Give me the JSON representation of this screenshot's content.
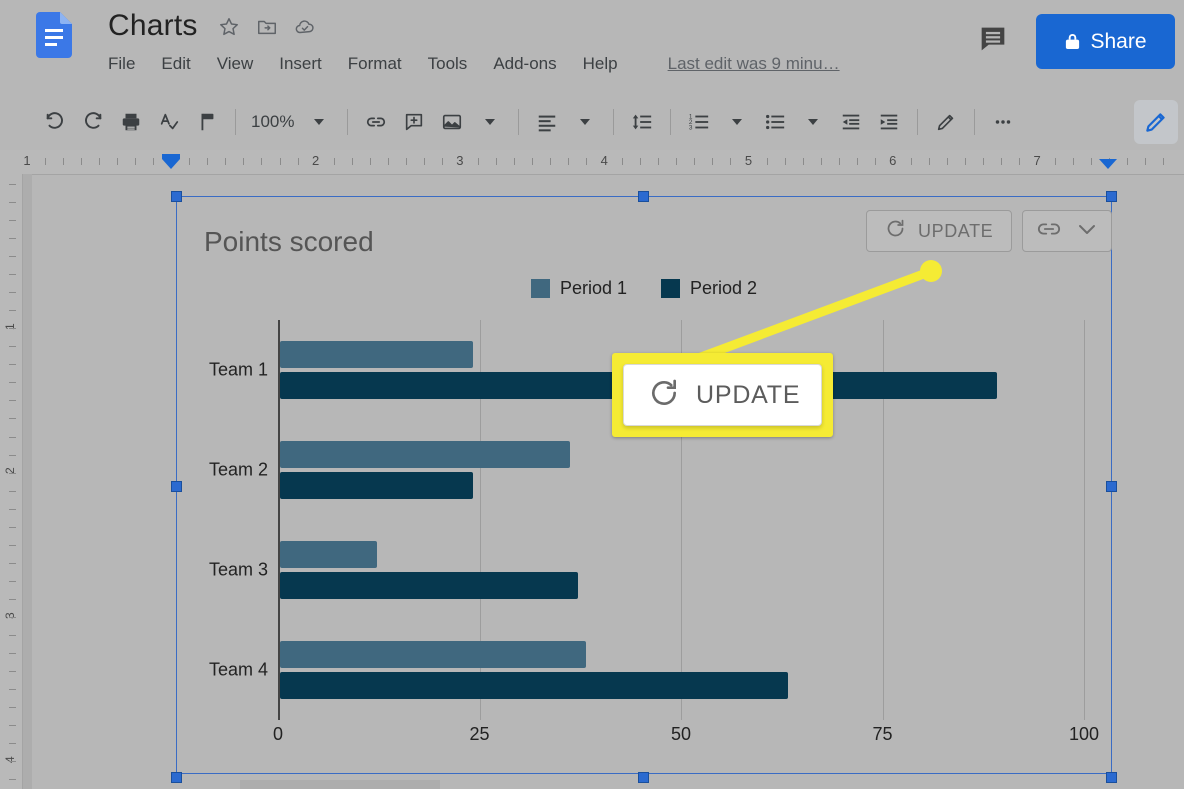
{
  "app": {
    "doc_title": "Charts",
    "logo_icon": "google-docs-icon",
    "title_icons": [
      "star-icon",
      "move-to-folder-icon",
      "cloud-saved-icon"
    ],
    "menus": [
      "File",
      "Edit",
      "View",
      "Insert",
      "Format",
      "Tools",
      "Add-ons",
      "Help"
    ],
    "last_edit": "Last edit was 9 minu…",
    "comment_icon": "comment-icon",
    "share_label": "Share",
    "share_icon": "lock-icon",
    "share_color": "#1967d2"
  },
  "toolbar": {
    "zoom_value": "100%",
    "items": [
      "undo-icon",
      "redo-icon",
      "print-icon",
      "spelling-check-icon",
      "paint-format-icon",
      "link-icon",
      "add-comment-icon",
      "insert-image-icon",
      "align-icon",
      "line-spacing-icon",
      "numbered-list-icon",
      "bulleted-list-icon",
      "decrease-indent-icon",
      "increase-indent-icon",
      "pencil-icon",
      "more-options-icon"
    ],
    "edit-mode-icon": "pencil-icon"
  },
  "ruler": {
    "horizontal_numbers": [
      "1",
      "1",
      "2",
      "3",
      "4",
      "5",
      "6",
      "7"
    ],
    "vertical_numbers": [
      "1",
      "2",
      "3",
      "4"
    ]
  },
  "chart_tools": {
    "update_label": "UPDATE",
    "update_icon": "refresh-icon",
    "link_icon": "link-icon",
    "dropdown_icon": "chevron-down-icon"
  },
  "callout": {
    "label": "UPDATE",
    "icon": "refresh-icon",
    "highlight_color": "#f5eb34"
  },
  "chart_data": {
    "type": "bar",
    "orientation": "horizontal",
    "title": "Points scored",
    "categories": [
      "Team 1",
      "Team 2",
      "Team 3",
      "Team 4"
    ],
    "series": [
      {
        "name": "Period 1",
        "color": "#40687f",
        "values": [
          24,
          36,
          12,
          38
        ]
      },
      {
        "name": "Period 2",
        "color": "#06384f",
        "values": [
          89,
          24,
          37,
          63
        ]
      }
    ],
    "xlabel": "",
    "ylabel": "",
    "xticks": [
      "0",
      "25",
      "50",
      "75",
      "100"
    ],
    "xlim": [
      0,
      100
    ],
    "grid": true,
    "legend_position": "top"
  }
}
